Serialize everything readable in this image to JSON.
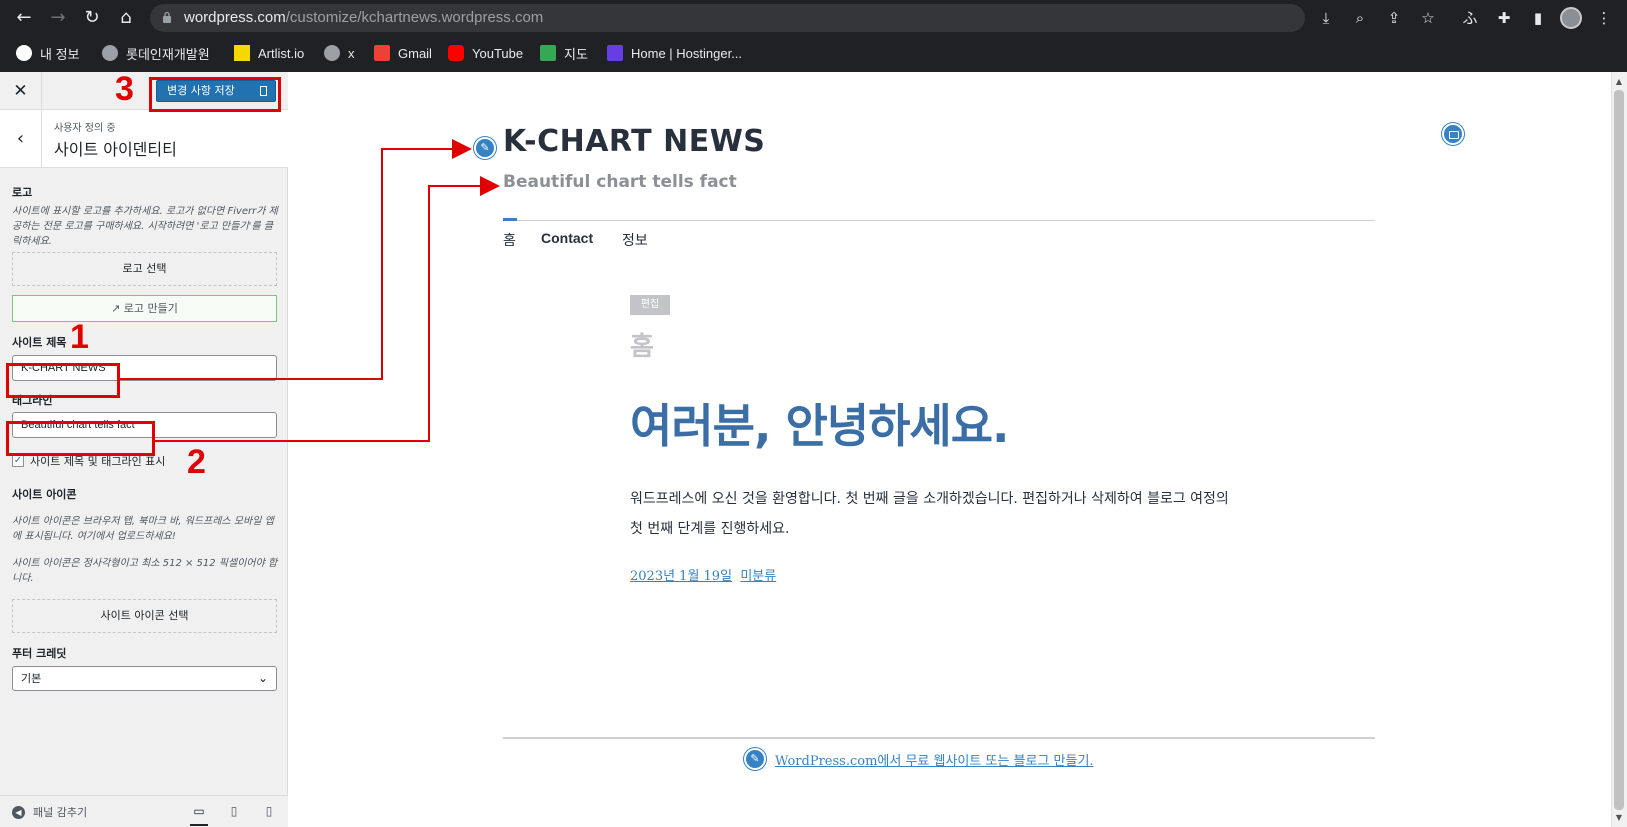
{
  "browser": {
    "url_host": "wordpress.com",
    "url_path": "/customize/kchartnews.wordpress.com",
    "toolbar_icons": [
      "install-icon",
      "zoom-icon",
      "share-icon",
      "star-icon",
      "extension-fu-icon",
      "puzzle-icon",
      "sidepanel-icon",
      "avatar",
      "menu-icon"
    ],
    "bookmarks": [
      {
        "label": "내 정보",
        "icon": "google-icon",
        "color": "#4285f4"
      },
      {
        "label": "롯데인재개발원",
        "icon": "globe-icon",
        "color": "#9aa0a6"
      },
      {
        "label": "Artlist.io",
        "icon": "artlist-icon",
        "color": "#f5d800"
      },
      {
        "label": "x",
        "icon": "globe-icon",
        "color": "#9aa0a6"
      },
      {
        "label": "Gmail",
        "icon": "gmail-icon",
        "color": "#ea4335"
      },
      {
        "label": "YouTube",
        "icon": "youtube-icon",
        "color": "#ff0000"
      },
      {
        "label": "지도",
        "icon": "maps-icon",
        "color": "#34a853"
      },
      {
        "label": "Home | Hostinger...",
        "icon": "hostinger-icon",
        "color": "#673de6"
      }
    ]
  },
  "panel": {
    "close": "✕",
    "save_label": "변경 사항 저장",
    "crumb": "사용자 정의 중",
    "section_title": "사이트 아이덴티티",
    "logo_label": "로고",
    "logo_desc": "사이트에 표시할 로고를 추가하세요. 로고가 없다면 Fiverr가 제공하는 전문 로고를 구매하세요. 시작하려면 '로고 만들기'를 클릭하세요.",
    "logo_select": "로고 선택",
    "logo_make": "로고 만들기",
    "site_title_label": "사이트 제목",
    "site_title_value": "K-CHART NEWS",
    "tagline_label": "태그라인",
    "tagline_value": "Beautiful chart tells fact",
    "show_title_tagline": "사이트 제목 및 태그라인 표시",
    "site_icon_label": "사이트 아이콘",
    "site_icon_desc1": "사이트 아이콘은 브라우저 탭, 북마크 바, 워드프레스 모바일 앱에 표시됩니다. 여기에서 업로드하세요!",
    "site_icon_desc2": "사이트 아이콘은 정사각형이고 최소 512 × 512 픽셀이어야 합니다.",
    "site_icon_select": "사이트 아이콘 선택",
    "footer_credit_label": "푸터 크레딧",
    "footer_credit_value": "기본",
    "collapse_label": "패널 감추기"
  },
  "preview": {
    "site_title": "K-CHART NEWS",
    "tagline": "Beautiful chart tells fact",
    "nav": [
      "홈",
      "Contact",
      "정보"
    ],
    "edit_badge": "편집",
    "page_title": "홈",
    "headline": "여러분, 안녕하세요.",
    "body": "워드프레스에 오신 것을 환영합니다. 첫 번째 글을 소개하겠습니다. 편집하거나 삭제하여 블로그 여정의 첫 번째 단계를 진행하세요.",
    "date": "2023년 1월 19일",
    "category": "미분류",
    "footer_credit": "WordPress.com에서 무료 웹사이트 또는 블로그 만들기."
  },
  "annotations": {
    "num1": "1",
    "num2": "2",
    "num3": "3",
    "color": "#e00000"
  },
  "colors": {
    "accent": "#2271b1",
    "link": "#3582c4",
    "headline": "#3a6ea5"
  }
}
